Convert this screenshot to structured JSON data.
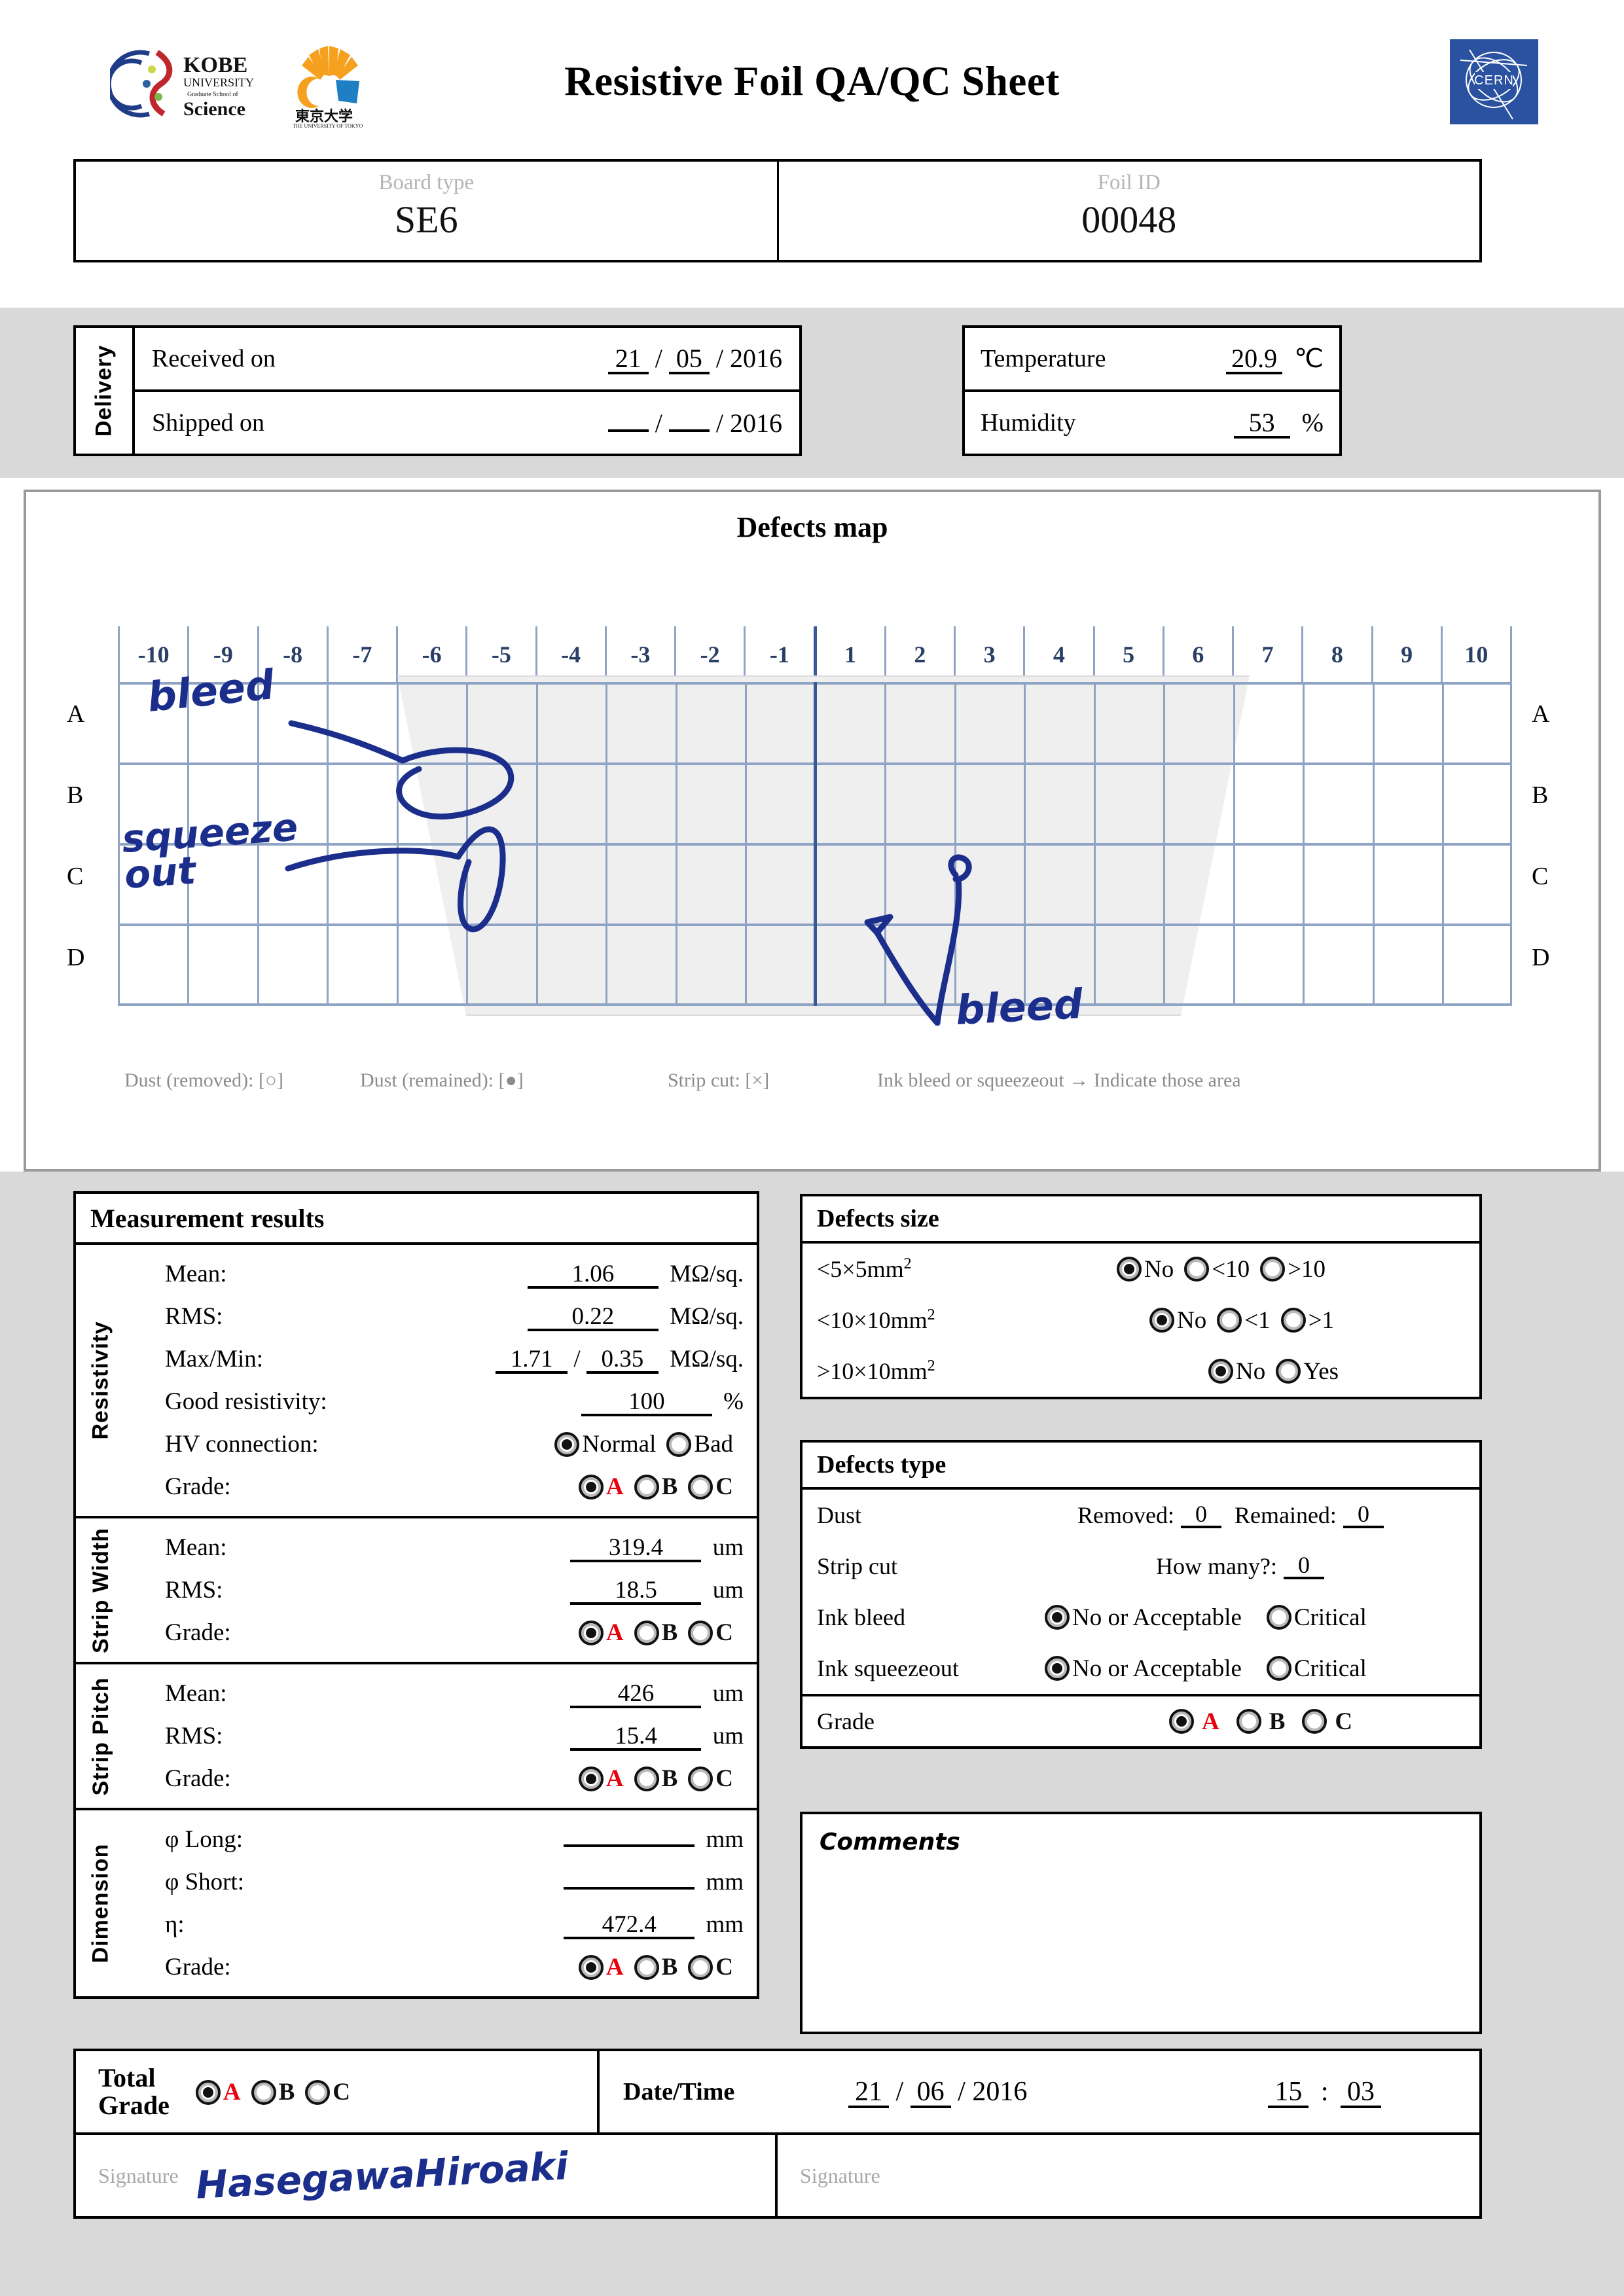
{
  "header": {
    "title": "Resistive Foil QA/QC Sheet",
    "logo_kobe": "kobe-university-graduate-school-of-science-logo",
    "logo_utokyo": "university-of-tokyo-logo",
    "logo_cern": "CERN"
  },
  "identification": {
    "board_type_label": "Board type",
    "board_type_value": "SE6",
    "foil_id_label": "Foil ID",
    "foil_id_value": "00048"
  },
  "delivery": {
    "side_label": "Delivery",
    "received_label": "Received on",
    "received_day": "21",
    "received_month": "05",
    "received_year": "2016",
    "shipped_label": "Shipped on",
    "shipped_day": "",
    "shipped_month": "",
    "shipped_year": "2016",
    "sep": "/"
  },
  "environment": {
    "temperature_label": "Temperature",
    "temperature_value": "20.9",
    "temperature_unit": "℃",
    "humidity_label": "Humidity",
    "humidity_value": "53",
    "humidity_unit": "%"
  },
  "defects_map": {
    "title": "Defects map",
    "columns": [
      "-10",
      "-9",
      "-8",
      "-7",
      "-6",
      "-5",
      "-4",
      "-3",
      "-2",
      "-1",
      "1",
      "2",
      "3",
      "4",
      "5",
      "6",
      "7",
      "8",
      "9",
      "10"
    ],
    "rows": [
      "A",
      "B",
      "C",
      "D"
    ],
    "legend": [
      "Dust (removed): [○]",
      "Dust (remained): [●]",
      "Strip cut: [×]",
      "Ink bleed or squeezeout → Indicate those area"
    ],
    "annotations": [
      {
        "text": "bleed",
        "note": "handwritten-left-upper"
      },
      {
        "text": "squeeze out",
        "note": "handwritten-left-lower"
      },
      {
        "text": "bleed",
        "note": "handwritten-bottom-center"
      }
    ]
  },
  "measurement": {
    "title": "Measurement results",
    "resistivity": {
      "side_label": "Resistivity",
      "mean_label": "Mean:",
      "mean_value": "1.06",
      "mean_unit": "MΩ/sq.",
      "rms_label": "RMS:",
      "rms_value": "0.22",
      "rms_unit": "MΩ/sq.",
      "maxmin_label": "Max/Min:",
      "max_value": "1.71",
      "min_value": "0.35",
      "maxmin_unit": "MΩ/sq.",
      "good_label": "Good resistivity:",
      "good_value": "100",
      "good_unit": "%",
      "hv_label": "HV connection:",
      "hv_options": [
        "Normal",
        "Bad"
      ],
      "hv_selected": "Normal",
      "grade_label": "Grade:",
      "grade_options": [
        "A",
        "B",
        "C"
      ],
      "grade_selected": "A"
    },
    "strip_width": {
      "side_label": "Strip Width",
      "mean_label": "Mean:",
      "mean_value": "319.4",
      "mean_unit": "um",
      "rms_label": "RMS:",
      "rms_value": "18.5",
      "rms_unit": "um",
      "grade_label": "Grade:",
      "grade_options": [
        "A",
        "B",
        "C"
      ],
      "grade_selected": "A"
    },
    "strip_pitch": {
      "side_label": "Strip Pitch",
      "mean_label": "Mean:",
      "mean_value": "426",
      "mean_unit": "um",
      "rms_label": "RMS:",
      "rms_value": "15.4",
      "rms_unit": "um",
      "grade_label": "Grade:",
      "grade_options": [
        "A",
        "B",
        "C"
      ],
      "grade_selected": "A"
    },
    "dimension": {
      "side_label": "Dimension",
      "long_label": "φ Long:",
      "long_value": "",
      "long_unit": "mm",
      "short_label": "φ Short:",
      "short_value": "",
      "short_unit": "mm",
      "eta_label": "η:",
      "eta_value": "472.4",
      "eta_unit": "mm",
      "grade_label": "Grade:",
      "grade_options": [
        "A",
        "B",
        "C"
      ],
      "grade_selected": "A"
    }
  },
  "defects_size": {
    "title": "Defects size",
    "rows": [
      {
        "label_main": "<5×5mm",
        "label_sup": "2",
        "options": [
          "No",
          "<10",
          ">10"
        ],
        "selected": "No"
      },
      {
        "label_main": "<10×10mm",
        "label_sup": "2",
        "options": [
          "No",
          "<1",
          ">1"
        ],
        "selected": "No"
      },
      {
        "label_main": ">10×10mm",
        "label_sup": "2",
        "options": [
          "No",
          "Yes"
        ],
        "selected": "No"
      }
    ]
  },
  "defects_type": {
    "title": "Defects type",
    "dust_label": "Dust",
    "dust_removed_label": "Removed:",
    "dust_removed_value": "0",
    "dust_remained_label": "Remained:",
    "dust_remained_value": "0",
    "stripcut_label": "Strip cut",
    "stripcut_howmany_label": "How many?:",
    "stripcut_howmany_value": "0",
    "inkbleed_label": "Ink bleed",
    "inkbleed_options": [
      "No or Acceptable",
      "Critical"
    ],
    "inkbleed_selected": "No or Acceptable",
    "inksqueeze_label": "Ink squeezeout",
    "inksqueeze_options": [
      "No or Acceptable",
      "Critical"
    ],
    "inksqueeze_selected": "No or Acceptable",
    "grade_label": "Grade",
    "grade_options": [
      "A",
      "B",
      "C"
    ],
    "grade_selected": "A"
  },
  "comments": {
    "label": "Comments",
    "value": ""
  },
  "footer": {
    "total_grade_label": "Total Grade",
    "total_grade_line1": "Total",
    "total_grade_line2": "Grade",
    "grade_options": [
      "A",
      "B",
      "C"
    ],
    "grade_selected": "A",
    "datetime_label": "Date/Time",
    "date_day": "21",
    "date_month": "06",
    "date_year": "2016",
    "time_hour": "15",
    "time_min": "03",
    "date_sep": "/",
    "time_sep": ":",
    "signature_label_1": "Signature",
    "signature_value_1": "HasegawaHiroaki",
    "signature_label_2": "Signature",
    "signature_value_2": ""
  },
  "colors": {
    "grade_a": "#e8000d",
    "grid_line": "#8fa4c4",
    "grid_major": "#3a5894",
    "ink": "#1c2e8c",
    "band": "#d9d9d9",
    "cern_blue": "#2a52a0"
  }
}
